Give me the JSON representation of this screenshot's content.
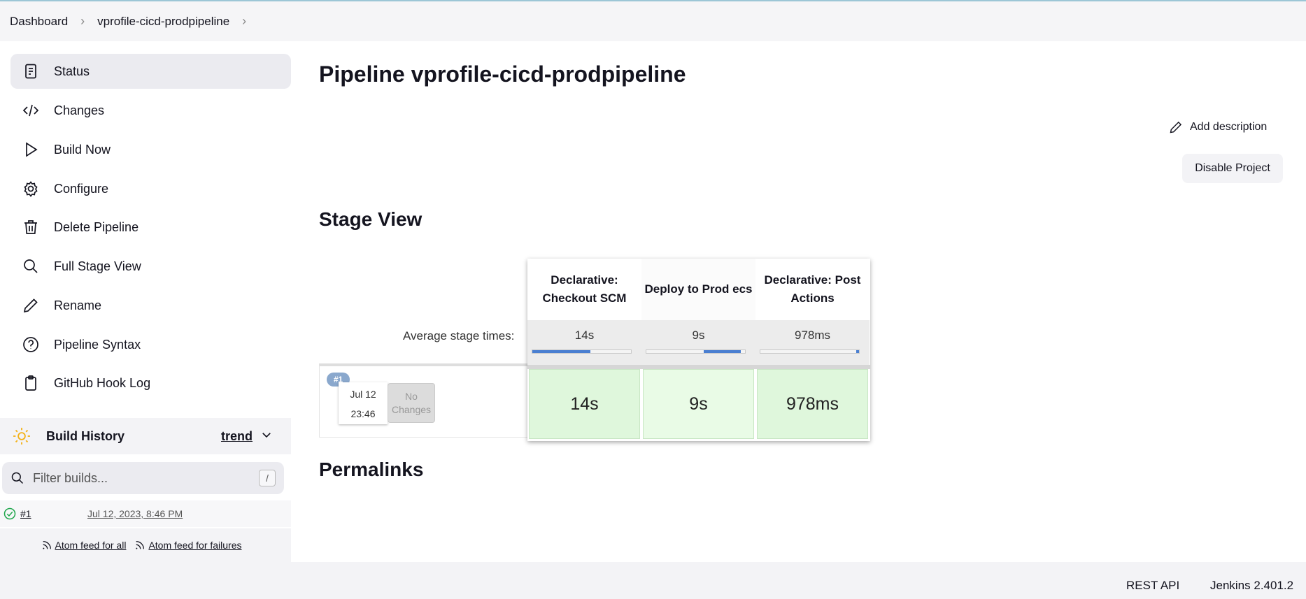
{
  "breadcrumb": {
    "items": [
      "Dashboard",
      "vprofile-cicd-prodpipeline"
    ]
  },
  "sidebar": {
    "tasks": [
      {
        "label": "Status",
        "icon": "status-icon",
        "active": true
      },
      {
        "label": "Changes",
        "icon": "code-icon"
      },
      {
        "label": "Build Now",
        "icon": "play-icon"
      },
      {
        "label": "Configure",
        "icon": "gear-icon"
      },
      {
        "label": "Delete Pipeline",
        "icon": "trash-icon"
      },
      {
        "label": "Full Stage View",
        "icon": "search-icon"
      },
      {
        "label": "Rename",
        "icon": "pencil-icon"
      },
      {
        "label": "Pipeline Syntax",
        "icon": "help-icon"
      },
      {
        "label": "GitHub Hook Log",
        "icon": "clipboard-icon"
      }
    ]
  },
  "build_history": {
    "title": "Build History",
    "trend": "trend",
    "filter_placeholder": "Filter builds...",
    "shortcut": "/",
    "builds": [
      {
        "number": "#1",
        "date": "Jul 12, 2023, 8:46 PM",
        "status": "success"
      }
    ],
    "feed_all": "Atom feed for all",
    "feed_failures": "Atom feed for failures"
  },
  "main": {
    "title": "Pipeline vprofile-cicd-prodpipeline",
    "add_description": "Add description",
    "disable_project": "Disable Project",
    "stage_view_title": "Stage View",
    "permalinks_title": "Permalinks"
  },
  "stage_view": {
    "average_label": "Average stage times:",
    "stages": [
      {
        "name": "Declarative: Checkout SCM",
        "avg": "14s",
        "avg_fill_start": 0.0,
        "avg_fill_end": 0.59,
        "run": "14s",
        "run_color": "#dff7dc"
      },
      {
        "name": "Deploy to Prod ecs",
        "avg": "9s",
        "avg_fill_start": 0.58,
        "avg_fill_end": 0.96,
        "run": "9s",
        "run_color": "#e9fbe6"
      },
      {
        "name": "Declarative: Post Actions",
        "avg": "978ms",
        "avg_fill_start": 0.97,
        "avg_fill_end": 1.0,
        "run": "978ms",
        "run_color": "#dff7dc"
      }
    ],
    "run": {
      "badge": "#1",
      "date": "Jul 12",
      "time": "23:46",
      "changes": "No Changes"
    }
  },
  "footer": {
    "rest_api": "REST API",
    "version": "Jenkins 2.401.2"
  }
}
